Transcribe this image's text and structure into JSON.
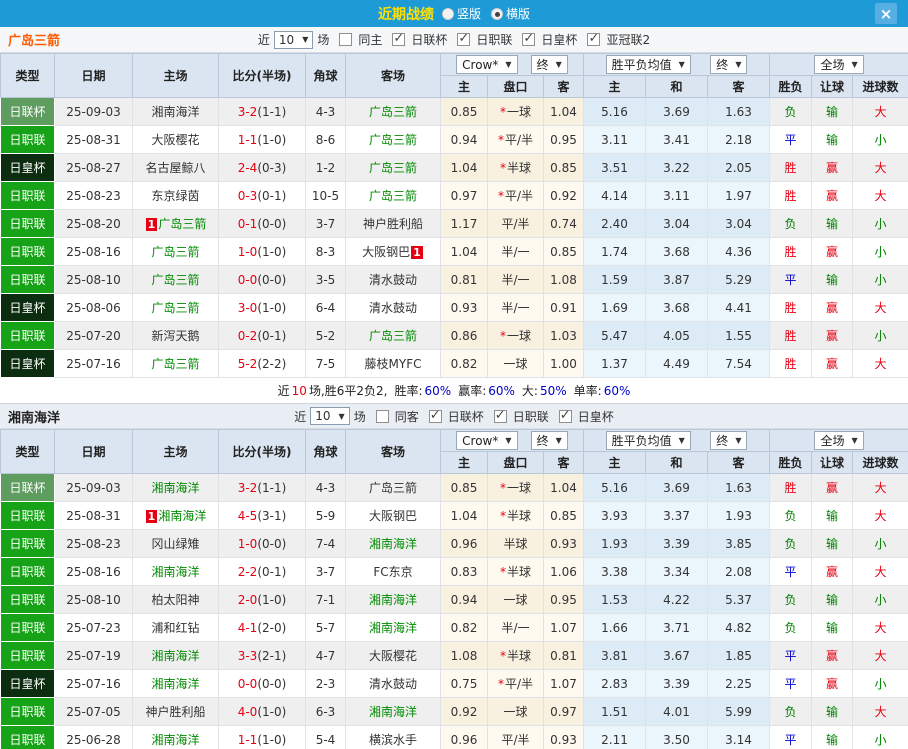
{
  "colors": {
    "topbar_blue": "#1e9ad6",
    "title_yellow": "#ffe100",
    "league_cup_green": "#5f9c5f",
    "league_j1_green": "#17a317",
    "emperor_dark_green": "#0c2d10",
    "score_red": "#e60012",
    "focus_team_green": "#008a00",
    "draw_blue": "#0000cc",
    "team1_orange": "#ff5a00"
  },
  "topbar": {
    "title": "近期战绩",
    "radios": [
      {
        "label": "竖版",
        "selected": false
      },
      {
        "label": "横版",
        "selected": true
      }
    ],
    "close_label": "×"
  },
  "table_header": {
    "main_cols": [
      "类型",
      "日期",
      "主场",
      "比分(半场)",
      "角球",
      "客场"
    ],
    "sub_cols": [
      "主",
      "盘口",
      "客",
      "主",
      "和",
      "客",
      "胜负",
      "让球",
      "进球数"
    ],
    "dropdowns": {
      "bookmaker": "Crow*",
      "final1": "终",
      "avg": "胜平负均值",
      "final2": "终",
      "scope": "全场"
    }
  },
  "sections": [
    {
      "team": "广岛三箭",
      "filter": {
        "prefix": "近",
        "count": "10",
        "suffix": "场",
        "same_label": "同主",
        "same_checked": false,
        "leagues": [
          {
            "label": "日联杯",
            "checked": true
          },
          {
            "label": "日职联",
            "checked": true
          },
          {
            "label": "日皇杯",
            "checked": true
          },
          {
            "label": "亚冠联2",
            "checked": true
          }
        ]
      },
      "rows": [
        {
          "league": "日联杯",
          "date": "25-09-03",
          "home": "湘南海洋",
          "home_focus": false,
          "home_badge": "",
          "score": "3-2",
          "half": "(1-1)",
          "corner": "4-3",
          "away": "广岛三箭",
          "away_focus": true,
          "away_badge": "",
          "h": "0.85",
          "star": true,
          "pk": "一球",
          "a": "1.04",
          "m_h": "5.16",
          "m_d": "3.69",
          "m_a": "1.63",
          "wdl": "负",
          "hcp": "输",
          "ou": "大"
        },
        {
          "league": "日职联",
          "date": "25-08-31",
          "home": "大阪樱花",
          "home_focus": false,
          "home_badge": "",
          "score": "1-1",
          "half": "(1-0)",
          "corner": "8-6",
          "away": "广岛三箭",
          "away_focus": true,
          "away_badge": "",
          "h": "0.94",
          "star": true,
          "pk": "平/半",
          "a": "0.95",
          "m_h": "3.11",
          "m_d": "3.41",
          "m_a": "2.18",
          "wdl": "平",
          "hcp": "输",
          "ou": "小"
        },
        {
          "league": "日皇杯",
          "date": "25-08-27",
          "home": "名古屋鲸八",
          "home_focus": false,
          "home_badge": "",
          "score": "2-4",
          "half": "(0-3)",
          "corner": "1-2",
          "away": "广岛三箭",
          "away_focus": true,
          "away_badge": "",
          "h": "1.04",
          "star": true,
          "pk": "半球",
          "a": "0.85",
          "m_h": "3.51",
          "m_d": "3.22",
          "m_a": "2.05",
          "wdl": "胜",
          "hcp": "赢",
          "ou": "大"
        },
        {
          "league": "日职联",
          "date": "25-08-23",
          "home": "东京绿茵",
          "home_focus": false,
          "home_badge": "",
          "score": "0-3",
          "half": "(0-1)",
          "corner": "10-5",
          "away": "广岛三箭",
          "away_focus": true,
          "away_badge": "",
          "h": "0.97",
          "star": true,
          "pk": "平/半",
          "a": "0.92",
          "m_h": "4.14",
          "m_d": "3.11",
          "m_a": "1.97",
          "wdl": "胜",
          "hcp": "赢",
          "ou": "大"
        },
        {
          "league": "日职联",
          "date": "25-08-20",
          "home": "广岛三箭",
          "home_focus": true,
          "home_badge": "1",
          "score": "0-1",
          "half": "(0-0)",
          "corner": "3-7",
          "away": "神户胜利船",
          "away_focus": false,
          "away_badge": "",
          "h": "1.17",
          "star": false,
          "pk": "平/半",
          "a": "0.74",
          "m_h": "2.40",
          "m_d": "3.04",
          "m_a": "3.04",
          "wdl": "负",
          "hcp": "输",
          "ou": "小"
        },
        {
          "league": "日职联",
          "date": "25-08-16",
          "home": "广岛三箭",
          "home_focus": true,
          "home_badge": "",
          "score": "1-0",
          "half": "(1-0)",
          "corner": "8-3",
          "away": "大阪钢巴",
          "away_focus": false,
          "away_badge": "1",
          "h": "1.04",
          "star": false,
          "pk": "半/一",
          "a": "0.85",
          "m_h": "1.74",
          "m_d": "3.68",
          "m_a": "4.36",
          "wdl": "胜",
          "hcp": "赢",
          "ou": "小"
        },
        {
          "league": "日职联",
          "date": "25-08-10",
          "home": "广岛三箭",
          "home_focus": true,
          "home_badge": "",
          "score": "0-0",
          "half": "(0-0)",
          "corner": "3-5",
          "away": "清水鼓动",
          "away_focus": false,
          "away_badge": "",
          "h": "0.81",
          "star": false,
          "pk": "半/一",
          "a": "1.08",
          "m_h": "1.59",
          "m_d": "3.87",
          "m_a": "5.29",
          "wdl": "平",
          "hcp": "输",
          "ou": "小"
        },
        {
          "league": "日皇杯",
          "date": "25-08-06",
          "home": "广岛三箭",
          "home_focus": true,
          "home_badge": "",
          "score": "3-0",
          "half": "(1-0)",
          "corner": "6-4",
          "away": "清水鼓动",
          "away_focus": false,
          "away_badge": "",
          "h": "0.93",
          "star": false,
          "pk": "半/一",
          "a": "0.91",
          "m_h": "1.69",
          "m_d": "3.68",
          "m_a": "4.41",
          "wdl": "胜",
          "hcp": "赢",
          "ou": "大"
        },
        {
          "league": "日职联",
          "date": "25-07-20",
          "home": "新泻天鹅",
          "home_focus": false,
          "home_badge": "",
          "score": "0-2",
          "half": "(0-1)",
          "corner": "5-2",
          "away": "广岛三箭",
          "away_focus": true,
          "away_badge": "",
          "h": "0.86",
          "star": true,
          "pk": "一球",
          "a": "1.03",
          "m_h": "5.47",
          "m_d": "4.05",
          "m_a": "1.55",
          "wdl": "胜",
          "hcp": "赢",
          "ou": "小"
        },
        {
          "league": "日皇杯",
          "date": "25-07-16",
          "home": "广岛三箭",
          "home_focus": true,
          "home_badge": "",
          "score": "5-2",
          "half": "(2-2)",
          "corner": "7-5",
          "away": "藤枝MYFC",
          "away_focus": false,
          "away_badge": "",
          "h": "0.82",
          "star": false,
          "pk": "一球",
          "a": "1.00",
          "m_h": "1.37",
          "m_d": "4.49",
          "m_a": "7.54",
          "wdl": "胜",
          "hcp": "赢",
          "ou": "大"
        }
      ],
      "summary": {
        "pre": "近",
        "count": "10",
        "mid": "场,胜6平2负2,",
        "stats": [
          {
            "label": "胜率:",
            "value": "60%"
          },
          {
            "label": "赢率:",
            "value": "60%"
          },
          {
            "label": "大:",
            "value": "50%"
          },
          {
            "label": "单率:",
            "value": "60%"
          }
        ]
      }
    },
    {
      "team": "湘南海洋",
      "filter": {
        "prefix": "近",
        "count": "10",
        "suffix": "场",
        "same_label": "同客",
        "same_checked": false,
        "leagues": [
          {
            "label": "日联杯",
            "checked": true
          },
          {
            "label": "日职联",
            "checked": true
          },
          {
            "label": "日皇杯",
            "checked": true
          }
        ]
      },
      "rows": [
        {
          "league": "日联杯",
          "date": "25-09-03",
          "home": "湘南海洋",
          "home_focus": true,
          "home_badge": "",
          "score": "3-2",
          "half": "(1-1)",
          "corner": "4-3",
          "away": "广岛三箭",
          "away_focus": false,
          "away_badge": "",
          "h": "0.85",
          "star": true,
          "pk": "一球",
          "a": "1.04",
          "m_h": "5.16",
          "m_d": "3.69",
          "m_a": "1.63",
          "wdl": "胜",
          "hcp": "赢",
          "ou": "大"
        },
        {
          "league": "日职联",
          "date": "25-08-31",
          "home": "湘南海洋",
          "home_focus": true,
          "home_badge": "1",
          "score": "4-5",
          "half": "(3-1)",
          "corner": "5-9",
          "away": "大阪钢巴",
          "away_focus": false,
          "away_badge": "",
          "h": "1.04",
          "star": true,
          "pk": "半球",
          "a": "0.85",
          "m_h": "3.93",
          "m_d": "3.37",
          "m_a": "1.93",
          "wdl": "负",
          "hcp": "输",
          "ou": "大"
        },
        {
          "league": "日职联",
          "date": "25-08-23",
          "home": "冈山绿雉",
          "home_focus": false,
          "home_badge": "",
          "score": "1-0",
          "half": "(0-0)",
          "corner": "7-4",
          "away": "湘南海洋",
          "away_focus": true,
          "away_badge": "",
          "h": "0.96",
          "star": false,
          "pk": "半球",
          "a": "0.93",
          "m_h": "1.93",
          "m_d": "3.39",
          "m_a": "3.85",
          "wdl": "负",
          "hcp": "输",
          "ou": "小"
        },
        {
          "league": "日职联",
          "date": "25-08-16",
          "home": "湘南海洋",
          "home_focus": true,
          "home_badge": "",
          "score": "2-2",
          "half": "(0-1)",
          "corner": "3-7",
          "away": "FC东京",
          "away_focus": false,
          "away_badge": "",
          "h": "0.83",
          "star": true,
          "pk": "半球",
          "a": "1.06",
          "m_h": "3.38",
          "m_d": "3.34",
          "m_a": "2.08",
          "wdl": "平",
          "hcp": "赢",
          "ou": "大"
        },
        {
          "league": "日职联",
          "date": "25-08-10",
          "home": "柏太阳神",
          "home_focus": false,
          "home_badge": "",
          "score": "2-0",
          "half": "(1-0)",
          "corner": "7-1",
          "away": "湘南海洋",
          "away_focus": true,
          "away_badge": "",
          "h": "0.94",
          "star": false,
          "pk": "一球",
          "a": "0.95",
          "m_h": "1.53",
          "m_d": "4.22",
          "m_a": "5.37",
          "wdl": "负",
          "hcp": "输",
          "ou": "小"
        },
        {
          "league": "日职联",
          "date": "25-07-23",
          "home": "浦和红钻",
          "home_focus": false,
          "home_badge": "",
          "score": "4-1",
          "half": "(2-0)",
          "corner": "5-7",
          "away": "湘南海洋",
          "away_focus": true,
          "away_badge": "",
          "h": "0.82",
          "star": false,
          "pk": "半/一",
          "a": "1.07",
          "m_h": "1.66",
          "m_d": "3.71",
          "m_a": "4.82",
          "wdl": "负",
          "hcp": "输",
          "ou": "大"
        },
        {
          "league": "日职联",
          "date": "25-07-19",
          "home": "湘南海洋",
          "home_focus": true,
          "home_badge": "",
          "score": "3-3",
          "half": "(2-1)",
          "corner": "4-7",
          "away": "大阪樱花",
          "away_focus": false,
          "away_badge": "",
          "h": "1.08",
          "star": true,
          "pk": "半球",
          "a": "0.81",
          "m_h": "3.81",
          "m_d": "3.67",
          "m_a": "1.85",
          "wdl": "平",
          "hcp": "赢",
          "ou": "大"
        },
        {
          "league": "日皇杯",
          "date": "25-07-16",
          "home": "湘南海洋",
          "home_focus": true,
          "home_badge": "",
          "score": "0-0",
          "half": "(0-0)",
          "corner": "2-3",
          "away": "清水鼓动",
          "away_focus": false,
          "away_badge": "",
          "h": "0.75",
          "star": true,
          "pk": "平/半",
          "a": "1.07",
          "m_h": "2.83",
          "m_d": "3.39",
          "m_a": "2.25",
          "wdl": "平",
          "hcp": "赢",
          "ou": "小"
        },
        {
          "league": "日职联",
          "date": "25-07-05",
          "home": "神户胜利船",
          "home_focus": false,
          "home_badge": "",
          "score": "4-0",
          "half": "(1-0)",
          "corner": "6-3",
          "away": "湘南海洋",
          "away_focus": true,
          "away_badge": "",
          "h": "0.92",
          "star": false,
          "pk": "一球",
          "a": "0.97",
          "m_h": "1.51",
          "m_d": "4.01",
          "m_a": "5.99",
          "wdl": "负",
          "hcp": "输",
          "ou": "大"
        },
        {
          "league": "日职联",
          "date": "25-06-28",
          "home": "湘南海洋",
          "home_focus": true,
          "home_badge": "",
          "score": "1-1",
          "half": "(1-0)",
          "corner": "5-4",
          "away": "横滨水手",
          "away_focus": false,
          "away_badge": "",
          "h": "0.96",
          "star": false,
          "pk": "平/半",
          "a": "0.93",
          "m_h": "2.11",
          "m_d": "3.50",
          "m_a": "3.14",
          "wdl": "平",
          "hcp": "输",
          "ou": "小"
        }
      ],
      "summary": null
    }
  ]
}
